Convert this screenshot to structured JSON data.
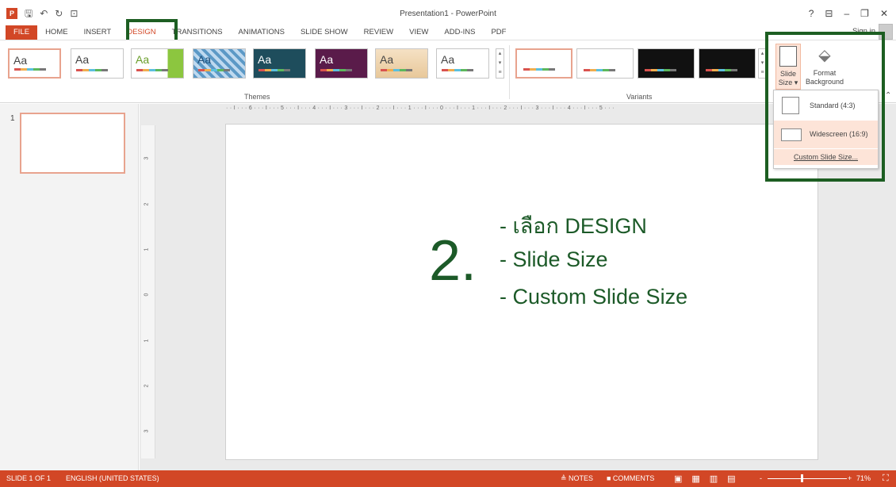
{
  "window": {
    "title": "Presentation1 - PowerPoint",
    "help": "?",
    "minimize": "–",
    "restore": "❐",
    "close": "✕"
  },
  "qat": {
    "app_icon": "P",
    "save": "🖫",
    "undo": "↶",
    "redo": "↻",
    "customize": "⊡"
  },
  "tabs": [
    "FILE",
    "HOME",
    "INSERT",
    "DESIGN",
    "TRANSITIONS",
    "ANIMATIONS",
    "SLIDE SHOW",
    "REVIEW",
    "VIEW",
    "ADD-INS",
    "PDF"
  ],
  "signin": "Sign in",
  "ribbon": {
    "theme_label": "Aa",
    "themes_group": "Themes",
    "variants_group": "Variants",
    "slide_size_label": "Slide",
    "slide_size_label2": "Size ▾",
    "format_bg_label": "Format",
    "format_bg_label2": "Background"
  },
  "dropdown": {
    "standard": "Standard (4:3)",
    "widescreen": "Widescreen (16:9)",
    "custom": "Custom Slide Size..."
  },
  "ruler_text": "· · I · · · 6 · · · I · · · 5 · · · I · · · 4 · · · I · · · 3 · · · I · · · 2 · · · I · · · 1 · · · I · · · 0 · · · I · · · 1 · · · I · · · 2 · · · I · · · 3 · · · I · · · 4 · · · I · · · 5 · · ·",
  "thumb_number": "1",
  "slide": {
    "step": "2.",
    "bullets": [
      "- เลือก DESIGN",
      "- Slide Size",
      "- Custom Slide Size"
    ]
  },
  "status": {
    "slide": "SLIDE 1 OF 1",
    "language": "ENGLISH (UNITED STATES)",
    "notes": "≜ NOTES",
    "comments": "■ COMMENTS",
    "zoom_minus": "-",
    "zoom_plus": "+",
    "zoom_pct": "71%",
    "zoom_level": 0.71
  },
  "colors": {
    "accent": "#d24726",
    "annotation": "#1d5e22"
  }
}
